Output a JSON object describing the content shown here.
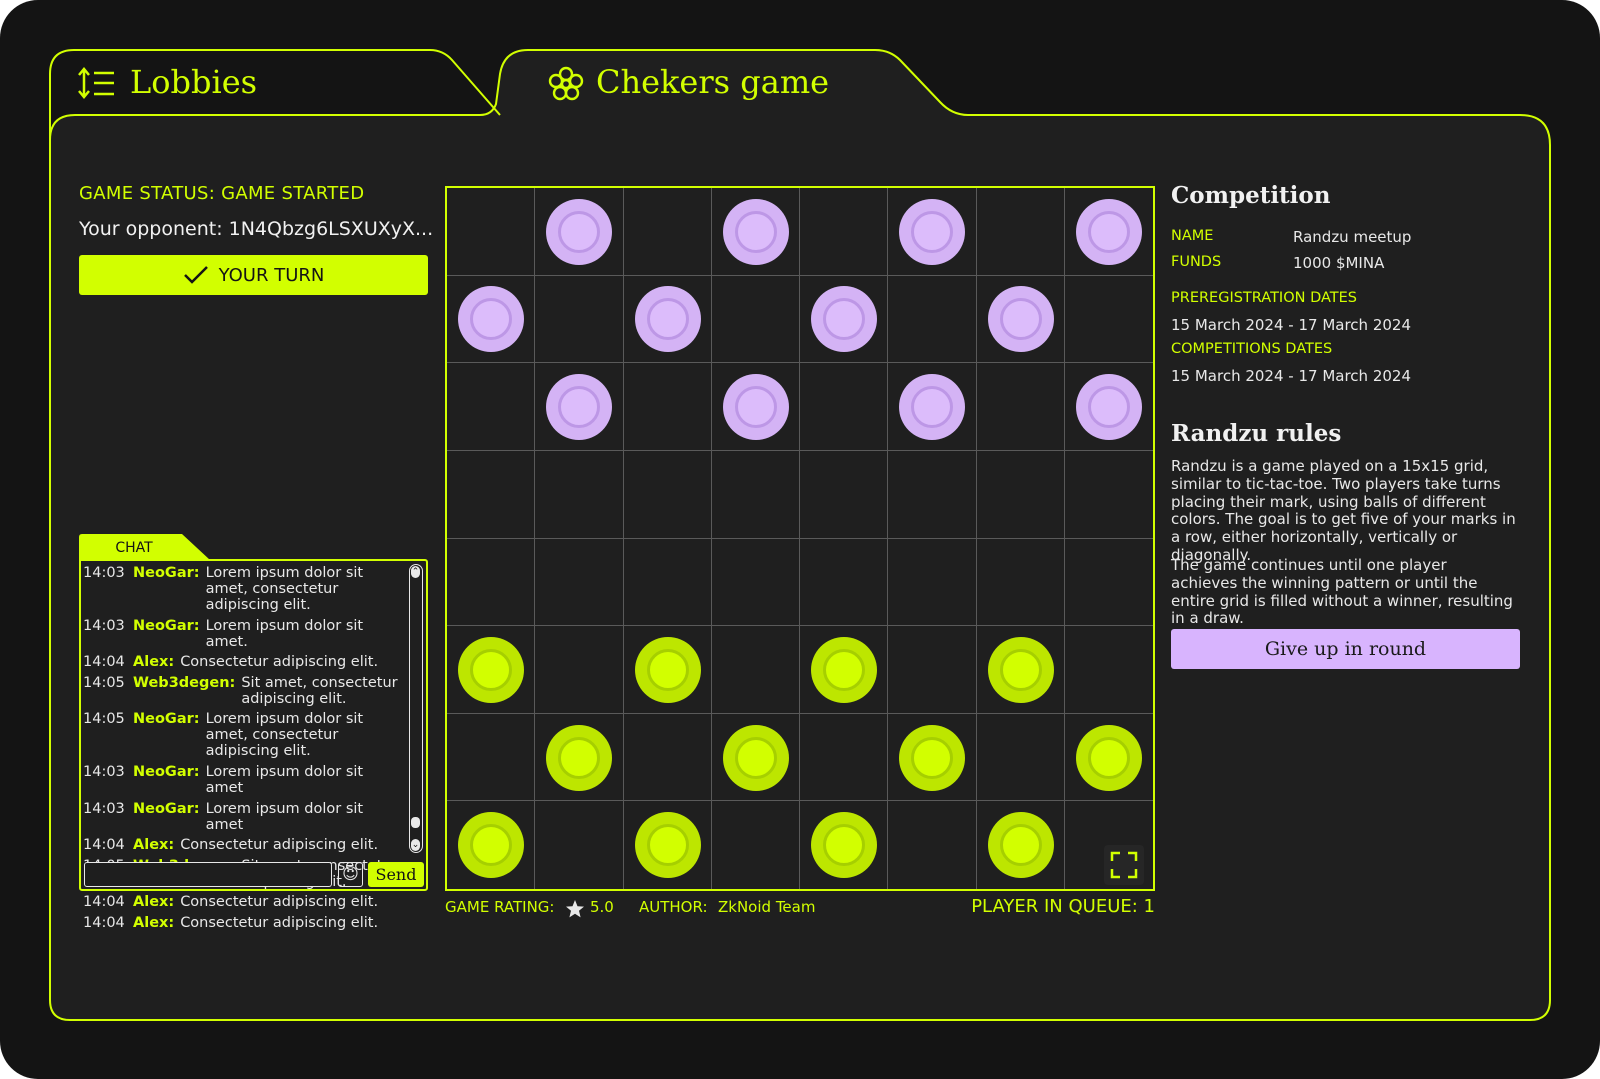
{
  "tabs": {
    "lobbies": "Lobbies",
    "game": "Chekers game"
  },
  "status": {
    "game_status": "GAME STATUS: GAME STARTED",
    "opponent": "Your opponent: 1N4Qbzg6LSXUXyX...",
    "turn_button": "YOUR TURN"
  },
  "chat": {
    "title": "CHAT",
    "messages": [
      {
        "time": "14:03",
        "author": "NeoGar:",
        "text": "Lorem ipsum dolor sit amet, consectetur adipiscing elit."
      },
      {
        "time": "14:03",
        "author": "NeoGar:",
        "text": "Lorem ipsum dolor sit amet."
      },
      {
        "time": "14:04",
        "author": "Alex:",
        "text": "Consectetur adipiscing elit."
      },
      {
        "time": "14:05",
        "author": "Web3degen:",
        "text": "Sit amet, consectetur adipiscing elit."
      },
      {
        "time": "14:05",
        "author": "NeoGar:",
        "text": "Lorem ipsum dolor sit amet, consectetur adipiscing elit."
      },
      {
        "time": "14:03",
        "author": "NeoGar:",
        "text": "Lorem ipsum dolor sit amet"
      },
      {
        "time": "14:03",
        "author": "NeoGar:",
        "text": "Lorem ipsum dolor sit amet"
      },
      {
        "time": "14:04",
        "author": "Alex:",
        "text": "Consectetur adipiscing elit."
      },
      {
        "time": "14:05",
        "author": "Web3degen:",
        "text": "Sit amet, consectetur adipiscing elit."
      },
      {
        "time": "14:04",
        "author": "Alex:",
        "text": "Consectetur adipiscing elit."
      },
      {
        "time": "14:04",
        "author": "Alex:",
        "text": "Consectetur adipiscing elit."
      }
    ],
    "input_value": "",
    "send_label": "Send"
  },
  "board": {
    "size": 8,
    "colors": {
      "purple": "#d4b3f5",
      "lime": "#d2ff00"
    },
    "pieces": [
      {
        "row": 0,
        "col": 1,
        "color": "purple"
      },
      {
        "row": 0,
        "col": 3,
        "color": "purple"
      },
      {
        "row": 0,
        "col": 5,
        "color": "purple"
      },
      {
        "row": 0,
        "col": 7,
        "color": "purple"
      },
      {
        "row": 1,
        "col": 0,
        "color": "purple"
      },
      {
        "row": 1,
        "col": 2,
        "color": "purple"
      },
      {
        "row": 1,
        "col": 4,
        "color": "purple"
      },
      {
        "row": 1,
        "col": 6,
        "color": "purple"
      },
      {
        "row": 2,
        "col": 1,
        "color": "purple"
      },
      {
        "row": 2,
        "col": 3,
        "color": "purple"
      },
      {
        "row": 2,
        "col": 5,
        "color": "purple"
      },
      {
        "row": 2,
        "col": 7,
        "color": "purple"
      },
      {
        "row": 5,
        "col": 0,
        "color": "lime"
      },
      {
        "row": 5,
        "col": 2,
        "color": "lime"
      },
      {
        "row": 5,
        "col": 4,
        "color": "lime"
      },
      {
        "row": 5,
        "col": 6,
        "color": "lime"
      },
      {
        "row": 6,
        "col": 1,
        "color": "lime"
      },
      {
        "row": 6,
        "col": 3,
        "color": "lime"
      },
      {
        "row": 6,
        "col": 5,
        "color": "lime"
      },
      {
        "row": 6,
        "col": 7,
        "color": "lime"
      },
      {
        "row": 7,
        "col": 0,
        "color": "lime"
      },
      {
        "row": 7,
        "col": 2,
        "color": "lime"
      },
      {
        "row": 7,
        "col": 4,
        "color": "lime"
      },
      {
        "row": 7,
        "col": 6,
        "color": "lime"
      }
    ]
  },
  "footer": {
    "rating_label": "GAME RATING:",
    "rating_value": "5.0",
    "author_label": "AUTHOR:",
    "author_value": "ZkNoid Team",
    "queue": "PLAYER IN QUEUE: 1"
  },
  "competition": {
    "heading": "Competition",
    "name_label": "NAME",
    "name_value": "Randzu meetup",
    "funds_label": "FUNDS",
    "funds_value": "1000 $MINA",
    "prereg_label": "PREREGISTRATION DATES",
    "prereg_value": "15 March 2024 - 17 March 2024",
    "comp_label": "COMPETITIONS DATES",
    "comp_value": "15 March 2024 - 17 March 2024"
  },
  "rules": {
    "heading": "Randzu rules",
    "p1": "Randzu is a game played on a 15x15 grid, similar to tic-tac-toe. Two players take turns placing their mark, using balls of different colors. The goal is to get five of your marks in a row, either horizontally, vertically or diagonally.",
    "p2": "The game continues until one player achieves the winning pattern or until the entire grid is filled without a winner, resulting in a draw.",
    "give_up": "Give up in round"
  }
}
